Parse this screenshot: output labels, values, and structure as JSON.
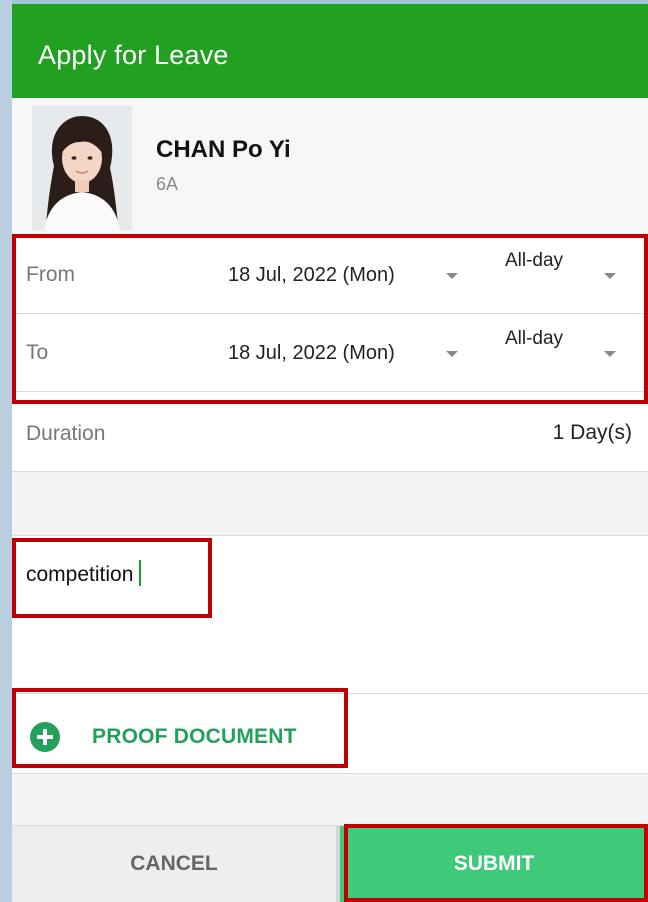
{
  "app_bar": {
    "title": "Apply for Leave",
    "color": "#22a021"
  },
  "student": {
    "name": "CHAN Po Yi",
    "class": "6A",
    "avatar_icon": "student-photo"
  },
  "from": {
    "label": "From",
    "date": "18 Jul, 2022 (Mon)",
    "session": "All-day"
  },
  "to": {
    "label": "To",
    "date": "18 Jul, 2022 (Mon)",
    "session": "All-day"
  },
  "duration": {
    "label": "Duration",
    "value": "1 Day(s)"
  },
  "reason": {
    "value": "competition"
  },
  "proof": {
    "label": "PROOF DOCUMENT",
    "icon": "plus-circle-icon",
    "color": "#23a05a"
  },
  "actions": {
    "cancel_label": "CANCEL",
    "submit_label": "SUBMIT",
    "submit_color": "#3fc97a"
  },
  "highlight_color": "#c00000"
}
